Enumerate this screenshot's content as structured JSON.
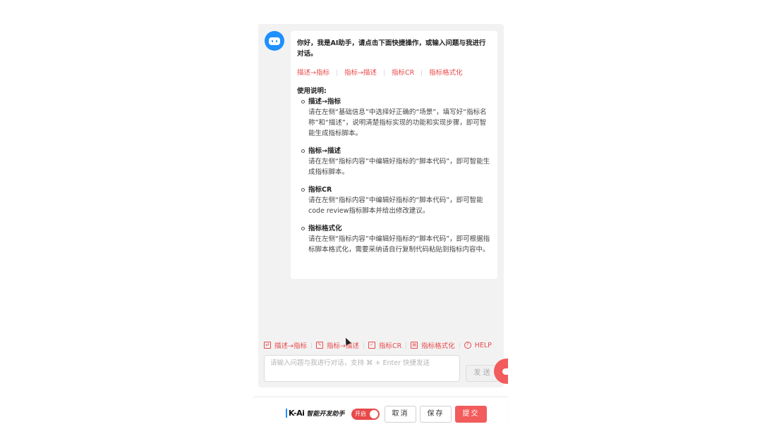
{
  "greeting": "你好，我是AI助手，请点击下面快捷操作，或输入问题与我进行对话。",
  "quick_actions": [
    "描述→指标",
    "指标→描述",
    "指标CR",
    "指标格式化"
  ],
  "usage": {
    "title": "使用说明:",
    "items": [
      {
        "name": "描述→指标",
        "desc": "请在左侧“基础信息”中选择好正确的“场景”，填写好“指标名称”和“描述”，说明清楚指标实现的功能和实现步骤，即可智能生成指标脚本。"
      },
      {
        "name": "指标→描述",
        "desc": "请在左侧“指标内容”中编辑好指标的“脚本代码”，即可智能生成指标脚本。"
      },
      {
        "name": "指标CR",
        "desc": "请在左侧“指标内容”中编辑好指标的“脚本代码”，即可智能code review指标脚本并给出修改建议。"
      },
      {
        "name": "指标格式化",
        "desc": "请在左侧“指标内容”中编辑好指标的“脚本代码”，即可根据指标脚本格式化，需要采纳请自行复制代码粘贴到指标内容中。"
      }
    ]
  },
  "toolbar": {
    "items": [
      {
        "label": "描述→指标",
        "icon": "translate-icon"
      },
      {
        "label": "指标→描述",
        "icon": "edit-icon"
      },
      {
        "label": "指标CR",
        "icon": "document-check-icon"
      },
      {
        "label": "指标格式化",
        "icon": "format-brush-icon"
      },
      {
        "label": "HELP",
        "icon": "help-icon"
      }
    ]
  },
  "input": {
    "placeholder": "请输入问题与我进行对话，支持 ⌘ + Enter 快捷发送"
  },
  "send_label": "发 送",
  "footer": {
    "brand_logo": "K-Ai",
    "brand_name": "智能开发助手",
    "toggle_label": "开启",
    "cancel_label": "取消",
    "save_label": "保存",
    "submit_label": "提交"
  },
  "colors": {
    "accent": "#e84a4a",
    "avatar": "#1e90ff",
    "primary_button": "#f25c5c"
  }
}
